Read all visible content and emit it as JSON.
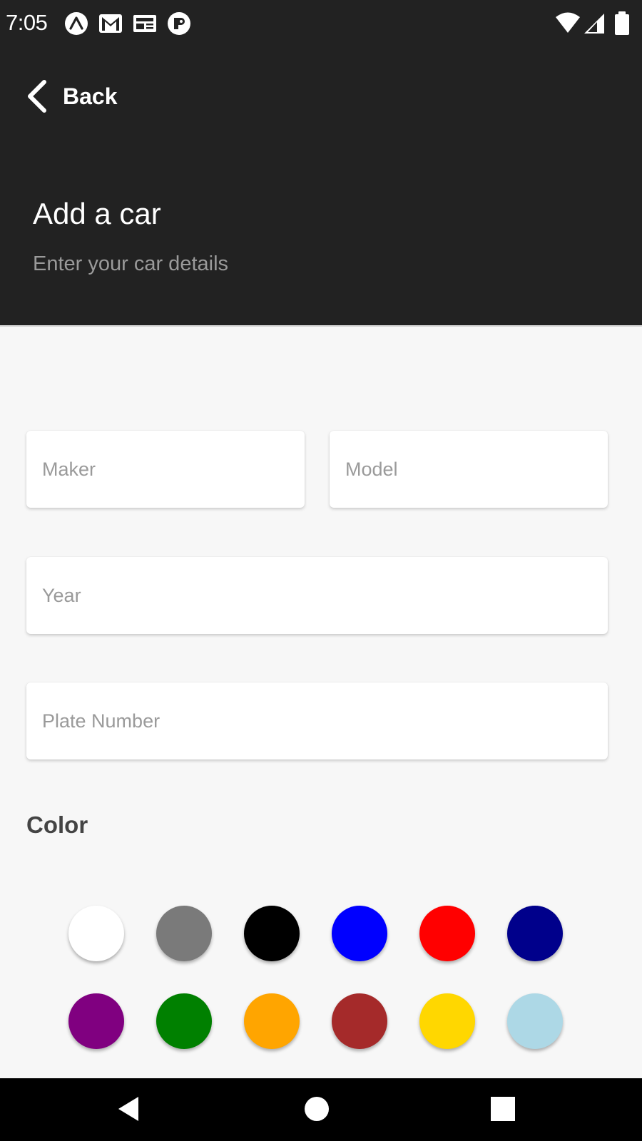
{
  "status_bar": {
    "time": "7:05",
    "notification_icons": [
      "expo-icon",
      "gmail-icon",
      "news-icon",
      "record-icon"
    ],
    "system_icons": [
      "wifi-icon",
      "signal-icon",
      "battery-icon"
    ]
  },
  "header": {
    "back_label": "Back",
    "title": "Add a car",
    "subtitle": "Enter your car details"
  },
  "form": {
    "maker_placeholder": "Maker",
    "model_placeholder": "Model",
    "year_placeholder": "Year",
    "plate_placeholder": "Plate Number",
    "color_label": "Color"
  },
  "colors": {
    "header_bg": "#222222",
    "content_bg": "#f7f7f7",
    "swatches": [
      "#ffffff",
      "#7a7a7a",
      "#000000",
      "#0000ff",
      "#ff0000",
      "#00008b",
      "#800080",
      "#008000",
      "#ffa500",
      "#a52a2a",
      "#ffd700",
      "#add8e6"
    ]
  },
  "nav_bar": {
    "buttons": [
      "back-triangle-icon",
      "home-circle-icon",
      "recents-square-icon"
    ]
  }
}
